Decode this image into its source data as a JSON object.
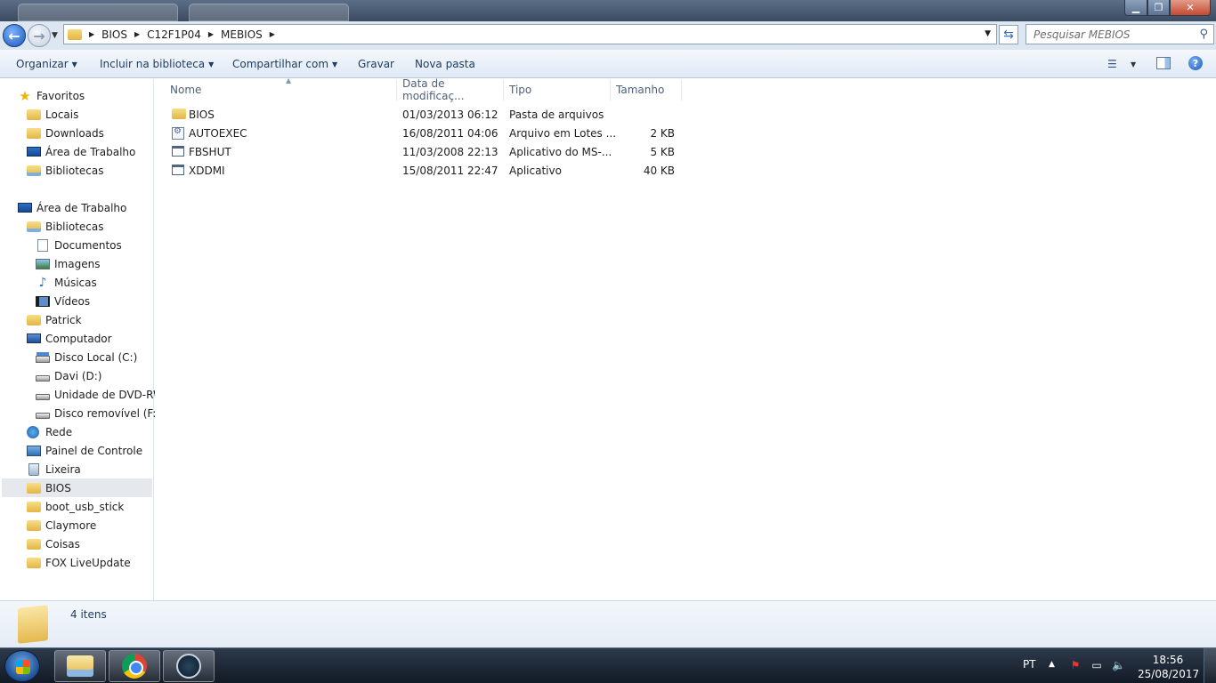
{
  "address": {
    "crumbs": [
      "BIOS",
      "C12F1P04",
      "MEBIOS"
    ],
    "search_placeholder": "Pesquisar MEBIOS"
  },
  "commandbar": {
    "organize": "Organizar",
    "include_library": "Incluir na biblioteca",
    "share": "Compartilhar com",
    "burn": "Gravar",
    "new_folder": "Nova pasta"
  },
  "nav": {
    "favorites": "Favoritos",
    "locais": "Locais",
    "downloads": "Downloads",
    "area_trabalho_fav": "Área de Trabalho",
    "bibliotecas_fav": "Bibliotecas",
    "area_trabalho": "Área de Trabalho",
    "bibliotecas": "Bibliotecas",
    "documentos": "Documentos",
    "imagens": "Imagens",
    "musicas": "Músicas",
    "videos": "Vídeos",
    "patrick": "Patrick",
    "computador": "Computador",
    "disco_c": "Disco Local (C:)",
    "davi_d": "Davi (D:)",
    "dvd": "Unidade de DVD-RW",
    "removivel_f": "Disco removível (F:)",
    "rede": "Rede",
    "painel": "Painel de Controle",
    "lixeira": "Lixeira",
    "bios": "BIOS",
    "boot_usb": "boot_usb_stick",
    "claymore": "Claymore",
    "coisas": "Coisas",
    "fox": "FOX LiveUpdate"
  },
  "columns": {
    "name": "Nome",
    "modified": "Data de modificaç...",
    "type": "Tipo",
    "size": "Tamanho"
  },
  "files": [
    {
      "name": "BIOS",
      "date": "01/03/2013 06:12",
      "type": "Pasta de arquivos",
      "size": "",
      "icon": "folder-icon"
    },
    {
      "name": "AUTOEXEC",
      "date": "16/08/2011 04:06",
      "type": "Arquivo em Lotes ...",
      "size": "2 KB",
      "icon": "batch-file-icon"
    },
    {
      "name": "FBSHUT",
      "date": "11/03/2008 22:13",
      "type": "Aplicativo do MS-...",
      "size": "5 KB",
      "icon": "application-icon"
    },
    {
      "name": "XDDMI",
      "date": "15/08/2011 22:47",
      "type": "Aplicativo",
      "size": "40 KB",
      "icon": "application-icon"
    }
  ],
  "details": {
    "count": "4 itens"
  },
  "taskbar": {
    "lang": "PT",
    "time": "18:56",
    "date": "25/08/2017"
  },
  "colors": {
    "accent": "#1d4f93",
    "folder": "#e3b546",
    "selection": "#e5e8ec"
  }
}
